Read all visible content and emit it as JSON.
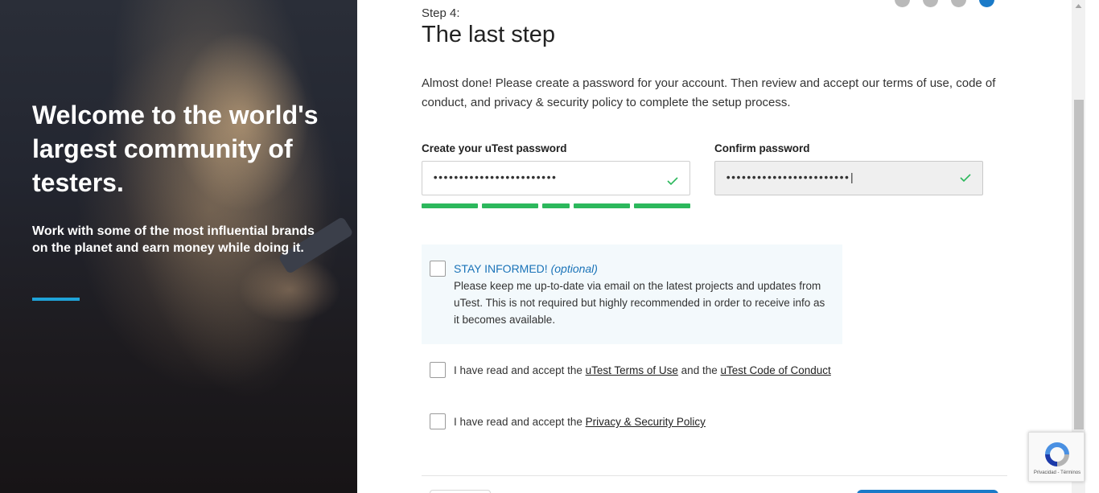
{
  "hero": {
    "title": "Welcome to the world's largest community of testers.",
    "subtitle": "Work with some of the most influential brands on the planet and earn money while doing it.",
    "accent_color": "#1fa3d8"
  },
  "steps": {
    "count": 4,
    "current": 4
  },
  "header": {
    "step_label": "Step 4:",
    "title": "The last step"
  },
  "intro_text": "Almost done! Please create a password for your account. Then review and accept our terms of use, code of conduct, and privacy & security policy to complete the setup process.",
  "password": {
    "label": "Create your uTest password",
    "value": "••••••••••••••••••••••••",
    "strength_segments": 5,
    "strength_color": "#2cb85c",
    "valid_icon": "check-icon"
  },
  "confirm_password": {
    "label": "Confirm password",
    "value": "••••••••••••••••••••••••|",
    "valid_icon": "check-icon"
  },
  "stay_informed": {
    "title": "STAY INFORMED!",
    "optional": "(optional)",
    "text": "Please keep me up-to-date via email on the latest projects and updates from uTest. This is not required but highly recommended in order to receive info as it becomes available.",
    "checked": false
  },
  "terms": {
    "prefix": "I have read and accept the ",
    "link1": "uTest Terms of Use",
    "middle": " and the ",
    "link2": "uTest Code of Conduct",
    "checked": false
  },
  "privacy": {
    "prefix": "I have read and accept the ",
    "link": "Privacy & Security Policy",
    "checked": false
  },
  "recaptcha": {
    "footer": "Privacidad - Términos"
  }
}
